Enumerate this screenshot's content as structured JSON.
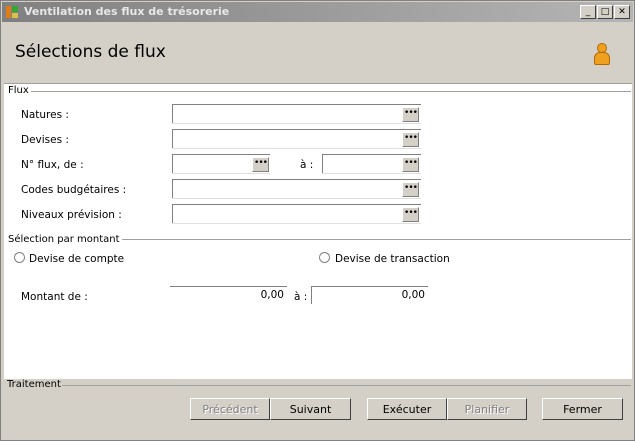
{
  "window": {
    "title": "Ventilation des flux de trésorerie",
    "min": "_",
    "max": "□",
    "close": "✕"
  },
  "header": {
    "title": "Sélections de flux"
  },
  "flux": {
    "group_label": "Flux",
    "natures_label": "Natures :",
    "natures_value": "",
    "devises_label": "Devises :",
    "devises_value": "",
    "nflux_label": "N° flux, de :",
    "nflux_from": "",
    "a_label": "à :",
    "nflux_to": "",
    "codes_label": "Codes budgétaires :",
    "codes_value": "",
    "niveaux_label": "Niveaux prévision :",
    "niveaux_value": "",
    "ellipsis": "•••"
  },
  "montant": {
    "group_label": "Sélection par montant",
    "radio_compte": "Devise de compte",
    "radio_transaction": "Devise de transaction",
    "montant_label": "Montant   de :",
    "from_value": "0,00",
    "a_label": "à :",
    "to_value": "0,00"
  },
  "traitement": {
    "group_label": "Traitement",
    "precedent": "Précédent",
    "suivant": "Suivant",
    "executer": "Exécuter",
    "planifier": "Planifier",
    "fermer": "Fermer"
  }
}
